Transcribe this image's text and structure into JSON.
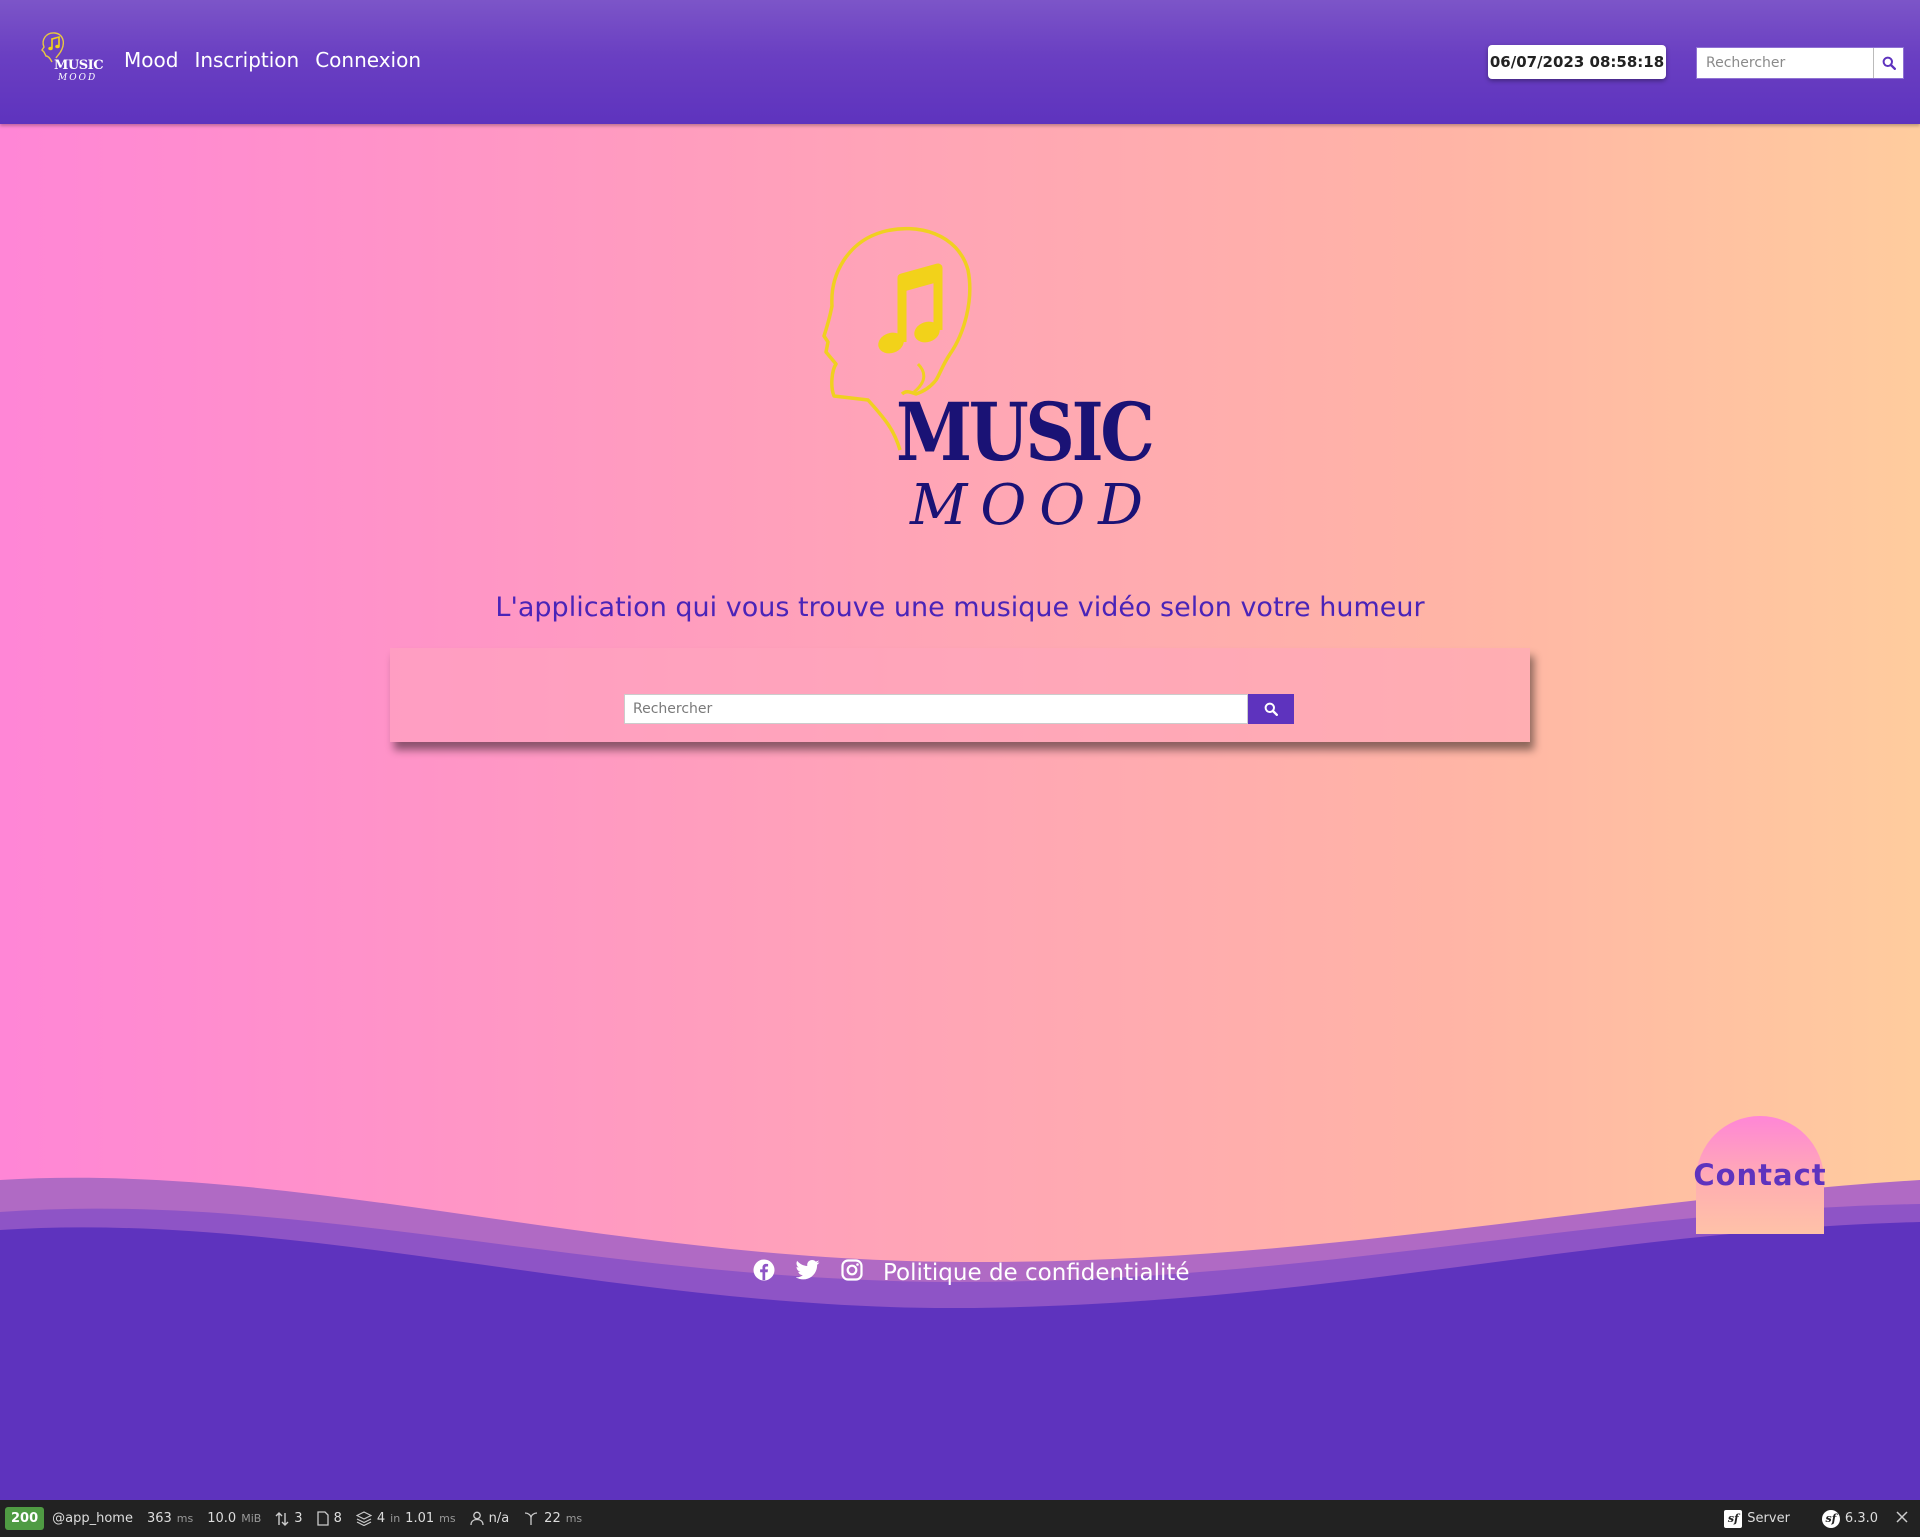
{
  "header": {
    "logo": {
      "line1": "MUSIC",
      "line2": "MOOD"
    },
    "nav": [
      {
        "label": "Mood"
      },
      {
        "label": "Inscription"
      },
      {
        "label": "Connexion"
      }
    ],
    "datetime": "06/07/2023 08:58:18",
    "search": {
      "placeholder": "Rechercher"
    }
  },
  "hero": {
    "logo": {
      "line1": "MUSIC",
      "line2": "MOOD"
    },
    "tagline": "L'application qui vous trouve une musique vidéo selon votre humeur",
    "search": {
      "placeholder": "Rechercher"
    }
  },
  "footer": {
    "contact_label": "Contact",
    "social": [
      "facebook-icon",
      "twitter-icon",
      "instagram-icon"
    ],
    "privacy_label": "Politique de confidentialité"
  },
  "toolbar": {
    "status": "200",
    "route": "@app_home",
    "time": "363",
    "time_unit": "ms",
    "memory": "10.0",
    "memory_unit": "MiB",
    "requests": "3",
    "forms": "8",
    "doctrine_count": "4",
    "doctrine_in": "in",
    "doctrine_time": "1.01",
    "doctrine_unit": "ms",
    "user": "n/a",
    "events_time": "22",
    "events_unit": "ms",
    "server_label": "Server",
    "version": "6.3.0"
  },
  "colors": {
    "header": "#6a3fc2",
    "accent": "#5e33be",
    "logo_yellow": "#f2d21a",
    "logo_navy": "#1a1275",
    "bg_left": "#ff86d6",
    "bg_right": "#ffcc9e"
  }
}
